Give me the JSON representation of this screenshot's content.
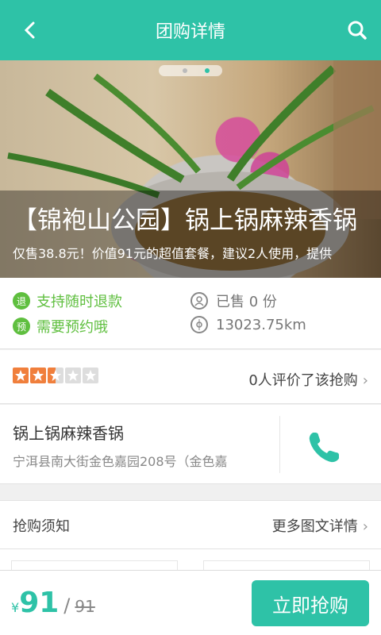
{
  "header": {
    "title": "团购详情",
    "back_icon": "chevron-left-icon",
    "search_icon": "search-icon",
    "bg_color": "#2ec2a7"
  },
  "hero": {
    "deal_title": "【锦袍山公园】锅上锅麻辣香锅",
    "deal_subtitle": "仅售38.8元！价值91元的超值套餐，建议2人使用，提供",
    "page_dots": 2,
    "active_dot": 1
  },
  "features": {
    "refund_badge": "退",
    "refund_text": "支持随时退款",
    "reserve_badge": "预",
    "reserve_text": "需要预约哦",
    "sold_text": "已售 0 份",
    "distance_text": "13023.75km"
  },
  "rating": {
    "stars": 2.5,
    "max_stars": 5,
    "count_text": "0人评价了该抢购"
  },
  "merchant": {
    "name": "锅上锅麻辣香锅",
    "address": "宁洱县南大街金色嘉园208号（金色嘉"
  },
  "notice": {
    "label": "抢购须知",
    "more": "更多图文详情"
  },
  "bottom": {
    "currency": "¥",
    "price": "91",
    "original_price": "91",
    "buy_label": "立即抢购"
  },
  "colors": {
    "accent": "#2ec2a7",
    "green": "#5fbf3f",
    "star": "#f07f3c"
  }
}
